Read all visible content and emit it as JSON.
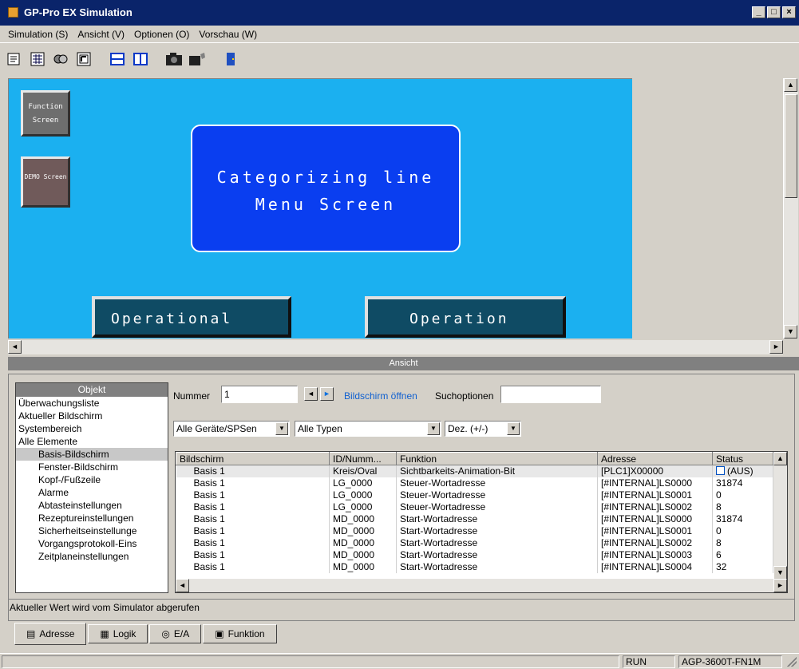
{
  "window": {
    "title": "GP-Pro EX Simulation",
    "minimize": "_",
    "maximize": "□",
    "close": "×"
  },
  "menu": [
    "Simulation (S)",
    "Ansicht (V)",
    "Optionen (O)",
    "Vorschau (W)"
  ],
  "screen": {
    "function_btn": "Function Screen",
    "demo_btn": "DEMO Screen",
    "panel_line1": "Categorizing line",
    "panel_line2": "Menu Screen",
    "op1": "Operational",
    "op2": "Operation"
  },
  "ansicht_label": "Ansicht",
  "objekt": {
    "header": "Objekt",
    "items": [
      "Überwachungsliste",
      "Aktueller Bildschirm",
      "Systembereich",
      "Alle Elemente",
      "Basis-Bildschirm",
      "Fenster-Bildschirm",
      "Kopf-/Fußzeile",
      "Alarme",
      "Abtasteinstellungen",
      "Rezeptureinstellungen",
      "Sicherheitseinstellunge",
      "Vorgangsprotokoll-Eins",
      "Zeitplaneinstellungen"
    ]
  },
  "search": {
    "nummer_label": "Nummer",
    "nummer_value": "1",
    "open_screen": "Bildschirm öffnen",
    "search_options": "Suchoptionen",
    "search_value": "",
    "devices": "Alle Geräte/SPSen",
    "types": "Alle Typen",
    "format": "Dez. (+/-)"
  },
  "grid": {
    "headers": [
      "Bildschirm",
      "ID/Numm...",
      "Funktion",
      "Adresse",
      "Status"
    ],
    "rows": [
      [
        "Basis 1",
        "Kreis/Oval",
        "Sichtbarkeits-Animation-Bit",
        "[PLC1]X00000",
        "(AUS)"
      ],
      [
        "Basis 1",
        "LG_0000",
        "Steuer-Wortadresse",
        "[#INTERNAL]LS0000",
        "31874"
      ],
      [
        "Basis 1",
        "LG_0000",
        "Steuer-Wortadresse",
        "[#INTERNAL]LS0001",
        "0"
      ],
      [
        "Basis 1",
        "LG_0000",
        "Steuer-Wortadresse",
        "[#INTERNAL]LS0002",
        "8"
      ],
      [
        "Basis 1",
        "MD_0000",
        "Start-Wortadresse",
        "[#INTERNAL]LS0000",
        "31874"
      ],
      [
        "Basis 1",
        "MD_0000",
        "Start-Wortadresse",
        "[#INTERNAL]LS0001",
        "0"
      ],
      [
        "Basis 1",
        "MD_0000",
        "Start-Wortadresse",
        "[#INTERNAL]LS0002",
        "8"
      ],
      [
        "Basis 1",
        "MD_0000",
        "Start-Wortadresse",
        "[#INTERNAL]LS0003",
        "6"
      ],
      [
        "Basis 1",
        "MD_0000",
        "Start-Wortadresse",
        "[#INTERNAL]LS0004",
        "32"
      ]
    ]
  },
  "status_message": "Aktueller Wert wird vom Simulator abgerufen",
  "tabs": [
    "Adresse",
    "Logik",
    "E/A",
    "Funktion"
  ],
  "statusbar": {
    "state": "RUN",
    "model": "AGP-3600T-FN1M"
  }
}
